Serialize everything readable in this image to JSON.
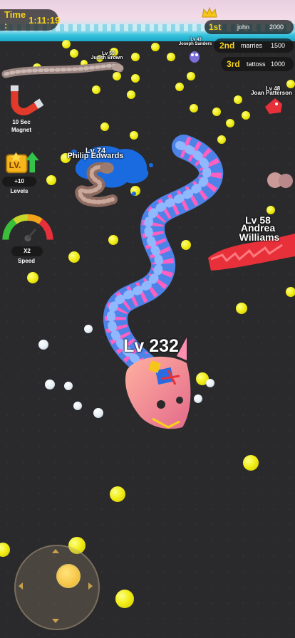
{
  "hud": {
    "timer_label": "Time :",
    "timer_value": "1:11:19"
  },
  "leaderboard": [
    {
      "rank": "1st",
      "name": "john",
      "score": "2000"
    },
    {
      "rank": "2nd",
      "name": "marries",
      "score": "1500"
    },
    {
      "rank": "3rd",
      "name": "tattoss",
      "score": "1000"
    }
  ],
  "powerups": {
    "magnet": {
      "icon": "magnet-icon",
      "label_line1": "10 Sec",
      "label_line2": "Magnet"
    },
    "levels": {
      "icon": "level-up-icon",
      "badge": "LV.",
      "value": "+10",
      "label": "Levels"
    },
    "speed": {
      "icon": "speedometer-icon",
      "value": "X2",
      "label": "Speed"
    }
  },
  "player": {
    "level_label": "Lv 232"
  },
  "enemies": [
    {
      "level": "Lv 58",
      "name_line1": "Andrea",
      "name_line2": "Williams"
    },
    {
      "level": "Lv 74",
      "name": "Philip Edwards"
    },
    {
      "level": "Lv 48",
      "name": "Joan Patterson"
    },
    {
      "level": "Lv 59",
      "name": "Judith Brown"
    },
    {
      "level": "Lv 43",
      "name": "Joseph Sanders"
    }
  ],
  "joystick": {
    "icon": "joystick-icon"
  },
  "colors": {
    "accent_yellow": "#f6d21a",
    "player_body_blue": "#4d83e8",
    "player_body_pink": "#ff5fc0",
    "enemy_red": "#e8303a"
  }
}
